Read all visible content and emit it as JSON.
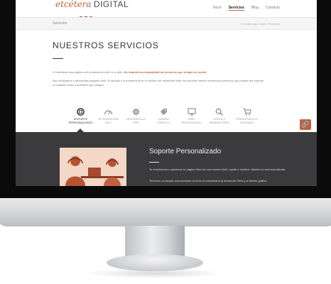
{
  "header": {
    "logo_script": "etcétera",
    "logo_word": "DIGITAL",
    "logo_dot_colors": [
      "#c4603e",
      "#6b6b6b",
      "#c4603e"
    ],
    "nav": [
      "Inicio",
      "Servicios",
      "Blog",
      "Contacto"
    ],
    "active_nav": "Servicios"
  },
  "breadcrumb": {
    "title": "Servicios",
    "path": "Tú estás aquí: Inicio / Servicios"
  },
  "page": {
    "heading": "NUESTROS SERVICIOS",
    "intro_before": "Si necesitas una página web profesional este es tu sitio. ",
    "intro_highlight": "No importa la complejidad del proyecto que tengas en mente.",
    "intro_2": "Nos dedicamos a desarrollar páginas Web. El estudio y la experiencia en el ámbito del desarrollo Web nos permite ofrecer numerosos servicios que podrán dar soporte a cualquier duda o problema que tengas."
  },
  "service_tabs": [
    {
      "line1": "SOPORTE",
      "line2": "PERSONALIZADO",
      "icon": "lifebuoy-icon",
      "active": true
    },
    {
      "line1": "OPTIMIZACIÓN",
      "line2": "SEO",
      "icon": "speedometer-icon",
      "active": false
    },
    {
      "line1": "DESARROLLO",
      "line2": "PHP",
      "icon": "gear-icon",
      "active": false
    },
    {
      "line1": "DISEÑO",
      "line2": "GRÁFICO",
      "icon": "tag-icon",
      "active": false
    },
    {
      "line1": "WEB",
      "line2": "PROFESIONAL",
      "icon": "monitor-icon",
      "active": false
    },
    {
      "line1": "GOOGLE",
      "line2": "WEBMASTERS",
      "icon": "search-icon",
      "active": false
    },
    {
      "line1": "PRESUPUESTO",
      "line2": "CERRADO",
      "icon": "cart-icon",
      "active": false
    }
  ],
  "active_service": {
    "title": "Soporte Personalizado",
    "text_1": "Te enseñamos a gestionar tu página Web de una manera fácil, rápida e intuitiva. Mantén tu web actualizada.",
    "text_2": "Tenemos un amplio conocimiento en todo lo relacionado al desarrollo Web y al diseño gráfico."
  },
  "side_widget": {
    "icon": "link-icon",
    "color": "#c4603e"
  },
  "colors": {
    "accent": "#c4603e",
    "dark_section": "#3b3b3d"
  }
}
